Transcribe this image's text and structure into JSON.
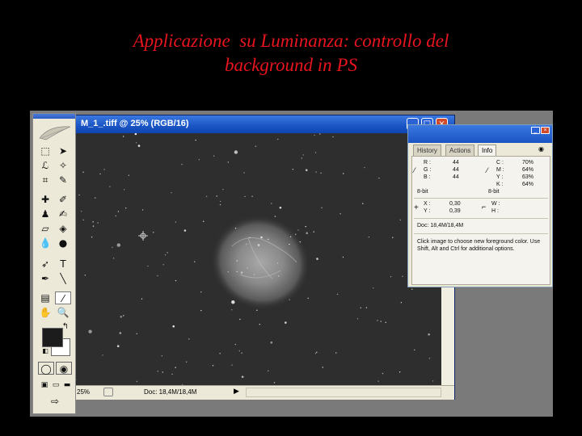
{
  "slide": {
    "title_line1": "Applicazione  su Luminanza: controllo del",
    "title_line2": "background in PS"
  },
  "document": {
    "title": "M_1_.tiff @ 25% (RGB/16)",
    "zoom": "25%",
    "doc_size": "Doc: 18,4M/18,4M"
  },
  "info_palette": {
    "tabs": [
      "History",
      "Actions",
      "Info"
    ],
    "active_tab": "Info",
    "rgb": {
      "r_label": "R :",
      "r": "44",
      "g_label": "G :",
      "g": "44",
      "b_label": "B :",
      "b": "44",
      "depth": "8-bit"
    },
    "cmyk": {
      "c_label": "C :",
      "c": "70%",
      "m_label": "M :",
      "m": "64%",
      "y_label": "Y :",
      "y": "63%",
      "k_label": "K :",
      "k": "64%",
      "depth": "8-bit"
    },
    "coords": {
      "x_label": "X :",
      "x": "0,30",
      "y_label": "Y :",
      "y": "0,39"
    },
    "size": {
      "w_label": "W :",
      "h_label": "H :"
    },
    "doc_size": "Doc: 18,4M/18,4M",
    "hint": "Click image to choose new foreground color.  Use Shift, Alt and Ctrl for additional options."
  },
  "colors": {
    "title_red": "#e8141e",
    "xp_blue": "#1a54c4",
    "foreground": "#1c1c1c",
    "background": "#ffffff"
  }
}
